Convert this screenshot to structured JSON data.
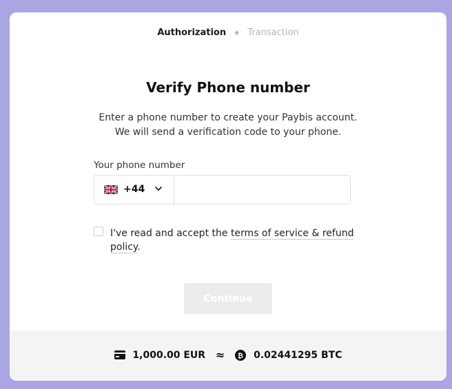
{
  "steps": {
    "active": "Authorization",
    "inactive": "Transaction"
  },
  "page": {
    "title": "Verify Phone number",
    "description_line1": "Enter a phone number to create your Paybis account.",
    "description_line2": "We will send a verification code to your phone."
  },
  "phone": {
    "label": "Your phone number",
    "country_code": "+44",
    "flag_icon": "uk-flag-icon",
    "value": "",
    "placeholder": ""
  },
  "terms": {
    "prefix": "I've read and accept the ",
    "link_text": "terms of service & refund policy",
    "suffix": ".",
    "checked": false
  },
  "continue_label": "Continue",
  "summary": {
    "fiat_amount": "1,000.00 EUR",
    "approx_symbol": "≈",
    "crypto_amount": "0.02441295 BTC",
    "fiat_icon": "card-icon",
    "crypto_icon": "bitcoin-icon"
  },
  "colors": {
    "background": "#a9a6e3",
    "card": "#ffffff",
    "footer": "#f4f4f5",
    "disabled_button": "#ececec"
  }
}
